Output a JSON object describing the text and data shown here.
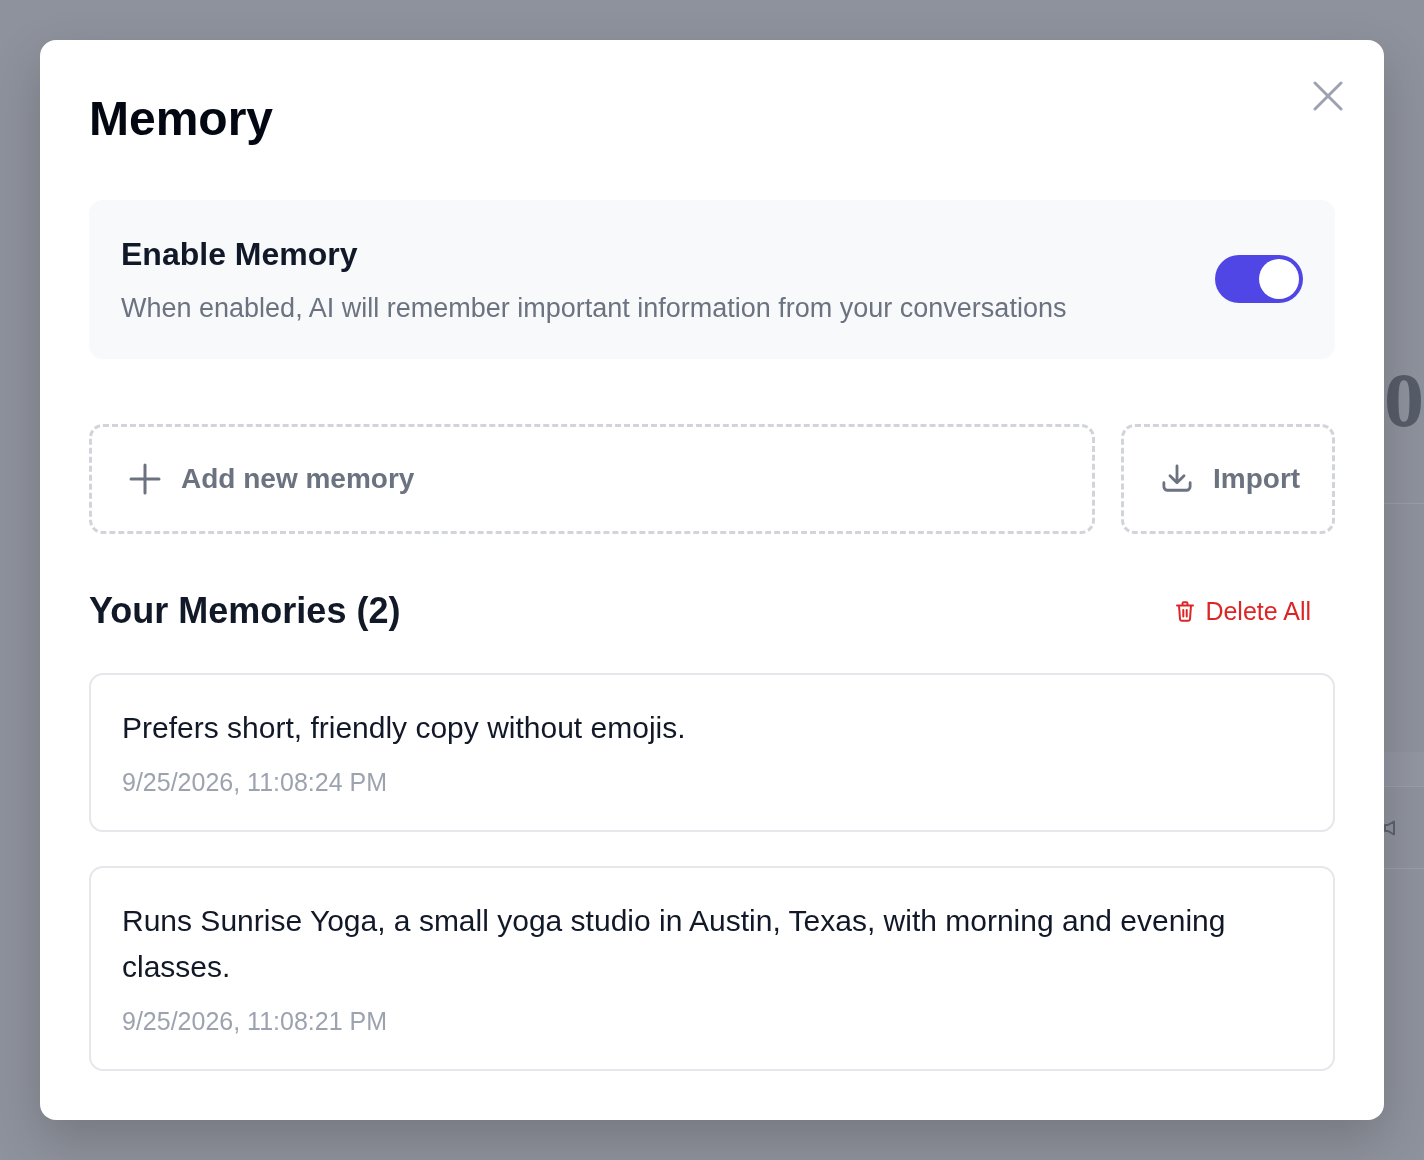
{
  "backdrop": {
    "heading_fragment": "o"
  },
  "dialog": {
    "title": "Memory"
  },
  "enable_memory": {
    "title": "Enable Memory",
    "description": "When enabled, AI will remember important information from your conversations",
    "on": true
  },
  "actions": [
    {
      "kind": "add",
      "label": "Add new memory"
    },
    {
      "kind": "import",
      "label": "Import"
    }
  ],
  "memories": {
    "title": "Your Memories (2)",
    "delete_all": "Delete All",
    "items": [
      {
        "text": "Prefers short, friendly copy without emojis.",
        "timestamp": "9/25/2026, 11:08:24 PM"
      },
      {
        "text": "Runs Sunrise Yoga, a small yoga studio in Austin, Texas, with morning and evening classes.",
        "timestamp": "9/25/2026, 11:08:21 PM"
      }
    ]
  }
}
